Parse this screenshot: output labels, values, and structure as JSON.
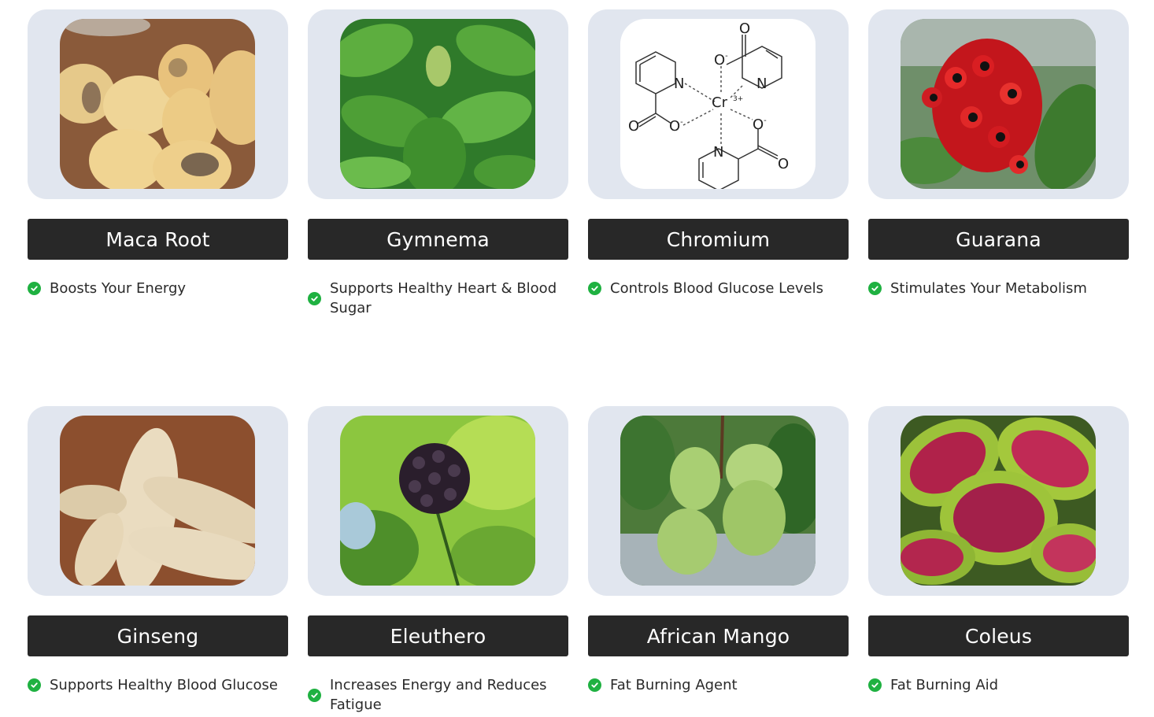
{
  "colors": {
    "card_bg": "#e1e6ef",
    "title_bar_bg": "#282828",
    "title_text": "#ffffff",
    "check_green": "#1fb141",
    "feature_text": "#2a2a2a"
  },
  "ingredients": [
    {
      "name": "Maca Root",
      "image": "maca-root-photo",
      "benefit": "Boosts Your Energy"
    },
    {
      "name": "Gymnema",
      "image": "gymnema-plant-photo",
      "benefit": "Supports Healthy Heart & Blood Sugar"
    },
    {
      "name": "Chromium",
      "image": "chromium-picolinate-structure",
      "benefit": "Controls Blood Glucose Levels",
      "structure_labels": {
        "metal": "Cr",
        "charge": "3+",
        "nitrogen": "N",
        "oxygen": "O",
        "oxide": "O",
        "minus": "-"
      }
    },
    {
      "name": "Guarana",
      "image": "guarana-berries-photo",
      "benefit": "Stimulates Your Metabolism"
    },
    {
      "name": "Ginseng",
      "image": "ginseng-root-photo",
      "benefit": "Supports Healthy Blood Glucose"
    },
    {
      "name": "Eleuthero",
      "image": "eleuthero-berries-photo",
      "benefit": "Increases Energy and Reduces Fatigue"
    },
    {
      "name": "African Mango",
      "image": "african-mango-photo",
      "benefit": "Fat Burning Agent"
    },
    {
      "name": "Coleus",
      "image": "coleus-leaves-photo",
      "benefit": "Fat Burning Aid"
    }
  ]
}
